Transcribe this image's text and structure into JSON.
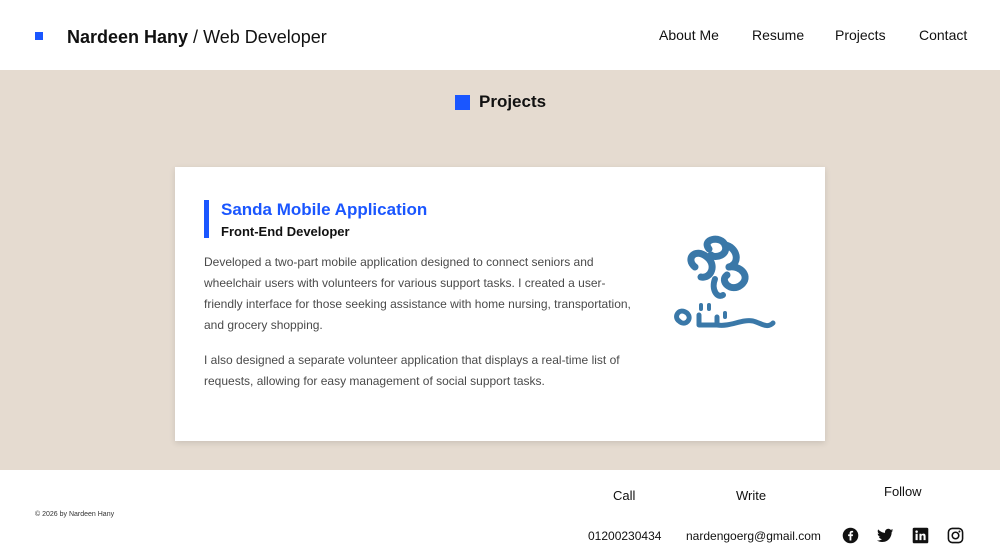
{
  "header": {
    "name": "Nardeen Hany",
    "separator": " / ",
    "title": "Web Developer",
    "accent_color": "#1a56ff",
    "nav": {
      "about": "About Me",
      "resume": "Resume",
      "projects": "Projects",
      "contact": "Contact"
    }
  },
  "main": {
    "background_color": "#e5dbd0",
    "section_title": "Projects",
    "project": {
      "title": "Sanda Mobile Application",
      "role": "Front-End Developer",
      "description_1": "Developed a two-part mobile application designed to connect seniors and wheelchair users with volunteers for various support tasks. I created a user-friendly interface for those seeking assistance with home nursing, transportation, and grocery shopping.",
      "description_2": "I also designed a separate volunteer application that displays a real-time list of requests, allowing for easy management of social support tasks.",
      "logo_icon": "sanda-logo-icon",
      "logo_color": "#3a78a8"
    }
  },
  "footer": {
    "copyright": "© 2026 by Nardeen Hany",
    "call_label": "Call",
    "write_label": "Write",
    "follow_label": "Follow",
    "phone": "01200230434",
    "email": "nardengoerg@gmail.com",
    "social_icons": [
      "facebook-icon",
      "twitter-icon",
      "linkedin-icon",
      "instagram-icon"
    ]
  }
}
